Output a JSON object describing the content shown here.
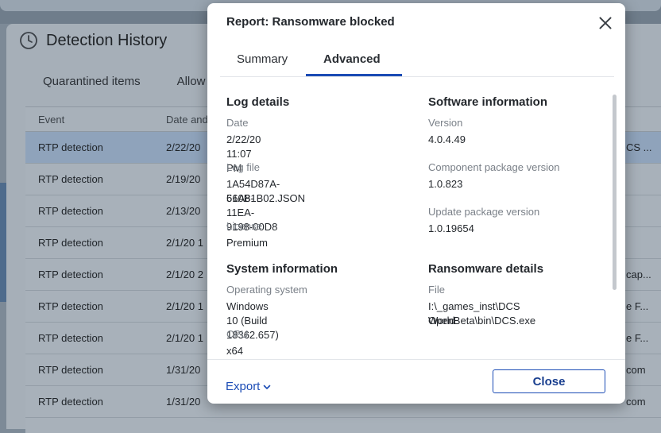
{
  "background": {
    "app_title": "Detection History",
    "tabs": [
      "Quarantined items",
      "Allow"
    ],
    "columns": [
      "Event",
      "Date and"
    ],
    "rows": [
      {
        "event": "RTP detection",
        "date": "2/22/20",
        "extra": "CS ...",
        "selected": true
      },
      {
        "event": "RTP detection",
        "date": "2/19/20",
        "extra": ""
      },
      {
        "event": "RTP detection",
        "date": "2/13/20",
        "extra": ""
      },
      {
        "event": "RTP detection",
        "date": "2/1/20 1",
        "extra": ""
      },
      {
        "event": "RTP detection",
        "date": "2/1/20 2",
        "extra": "cap..."
      },
      {
        "event": "RTP detection",
        "date": "2/1/20 1",
        "extra": "e F..."
      },
      {
        "event": "RTP detection",
        "date": "2/1/20 1",
        "extra": "e F..."
      },
      {
        "event": "RTP detection",
        "date": "1/31/20",
        "extra": "com"
      },
      {
        "event": "RTP detection",
        "date": "1/31/20",
        "extra": "com"
      }
    ]
  },
  "dialog": {
    "title": "Report: Ransomware blocked",
    "tabs": {
      "summary": "Summary",
      "advanced": "Advanced"
    },
    "active_tab": "advanced",
    "log_details": {
      "heading": "Log details",
      "date_label": "Date",
      "date_value": "2/22/20 11:07 PM",
      "log_file_label": "Log file",
      "log_file_value_line1": "1A54D87A-560B-11EA-9198-00D8",
      "log_file_value_line2": "61A81B02.JSON",
      "license_label": "License",
      "license_value": "Premium"
    },
    "software_information": {
      "heading": "Software information",
      "version_label": "Version",
      "version_value": "4.0.4.49",
      "component_label": "Component package version",
      "component_value": "1.0.823",
      "update_label": "Update package version",
      "update_value": "1.0.19654"
    },
    "system_information": {
      "heading": "System information",
      "os_label": "Operating system",
      "os_value": "Windows 10 (Build 18362.657)",
      "cpu_label": "CPU",
      "cpu_value": "x64"
    },
    "ransomware_details": {
      "heading": "Ransomware details",
      "file_label": "File",
      "file_value_line1": "I:\\_games_inst\\DCS World",
      "file_value_line2": "OpenBeta\\bin\\DCS.exe"
    },
    "footer": {
      "export_label": "Export",
      "close_label": "Close"
    }
  },
  "colors": {
    "accent": "#1a4bb5",
    "overlay": "#7d8a97",
    "selected_row": "#8fa3bb"
  },
  "icons": [
    "clock-history-icon",
    "close-icon",
    "chevron-down-icon"
  ]
}
